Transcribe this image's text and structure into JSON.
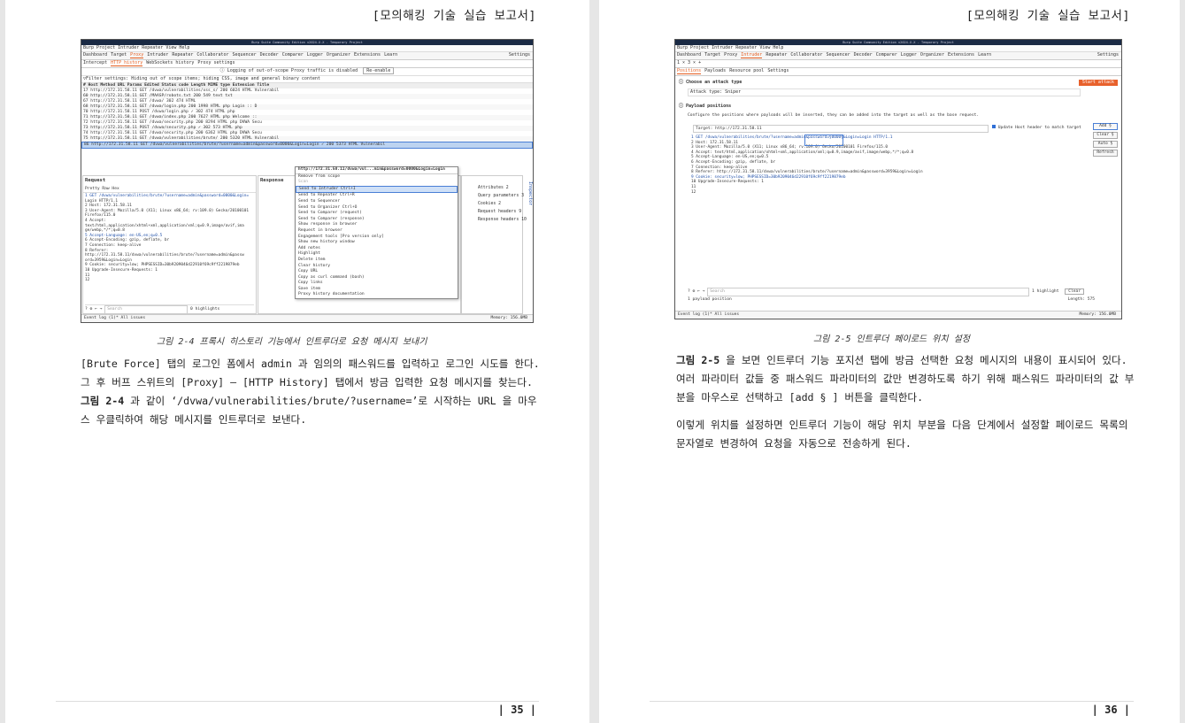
{
  "pages": [
    {
      "header": "[모의해킹 기술 실습 보고서]",
      "caption": "그림 2-4 프록시 히스토리 기능에서 인트루더로 요청 메시지 보내기",
      "paragraphs": [
        {
          "before": "[Brute Force] 탭의 로그인 폼에서 admin 과 임의의 패스워드를 입력하고 로그인 시도를 한다. 그 후 버프 스위트의 [Proxy] – [HTTP History] 탭에서 방금 입력한 요청 메시지를 찾는다. ",
          "bold": "그림 2-4",
          "after": " 과 같이 ‘/dvwa/vulnerabilities/brute/?username=’로 시작하는 URL 을 마우스 우클릭하여 해당 메시지를 인트루더로 보낸다."
        }
      ],
      "page_number": "| 35 |",
      "screenshot": {
        "window_title": "Burp Suite Community Edition v2024.X.X - Temporary Project",
        "menu": "Burp  Project  Intruder  Repeater  View  Help",
        "tabs": [
          "Dashboard",
          "Target",
          "Proxy",
          "Intruder",
          "Repeater",
          "Collaborator",
          "Sequencer",
          "Decoder",
          "Comparer",
          "Logger",
          "Organizer",
          "Extensions",
          "Learn"
        ],
        "settings_label": "Settings",
        "subtabs": [
          "Intercept",
          "HTTP history",
          "WebSockets history",
          "Proxy settings"
        ],
        "notice": "Logging of out-of-scope Proxy traffic is disabled",
        "notice_button": "Re-enable",
        "filter": "Filter settings: Hiding out of scope items; hiding CSS, image and general binary content",
        "columns": "#    Host                 Method   URL                                         Params  Edited  Status code  Length  MIME type  Extension  Title",
        "rows": [
          "17   http://172.31.58.11   GET      /dvwa/vulnerabilities/xss_s/                                      200          6024    HTML                  Vulnerabil",
          "60   http://172.31.58.11   GET      /MAASP/robots.txt                                                 200          549     text       txt",
          "67   http://172.31.58.11   GET      /dvwa/                                                            302          474     HTML",
          "68   http://172.31.58.11   GET      /dvwa/login.php                                                   200          1998    HTML       php        Login :: D",
          "70   http://172.31.58.11   POST     /dvwa/login.php                                ✓                  302          474     HTML       php",
          "71   http://172.31.58.11   GET      /dvwa/index.php                                                   200          7627    HTML       php        Welcome ::",
          "72   http://172.31.58.11   GET      /dvwa/security.php                                                200          8294    HTML       php        DVWA Secu",
          "73   http://172.31.58.11   POST     /dvwa/security.php                             ✓                  302          573     HTML       php",
          "74   http://172.31.58.11   GET      /dvwa/security.php                                                200          6362    HTML       php        DVWA Secu",
          "75   http://172.31.58.11   GET      /dvwa/vulnerabilities/brute/                                      200          5320    HTML                  Vulnerabil",
          "86   http://172.31.58.11   GET      /dvwa/vulnerabilities/brute/?username=admin&password=0000&Login=Login   ✓   200   5373   HTML          Vulnerabil"
        ],
        "request_title": "Request",
        "request_tabs": "Pretty   Raw   Hex",
        "request_lines": [
          "1  GET /dvwa/vulnerabilities/brute/?username=admin&password=0000&Login=",
          "   Login HTTP/1.1",
          "2  Host: 172.31.58.11",
          "3  User-Agent: Mozilla/5.0 (X11; Linux x86_64; rv:109.0) Gecko/20100101",
          "   Firefox/115.0",
          "4  Accept:",
          "   text/html,application/xhtml+xml,application/xml;q=0.9,image/avif,ima",
          "   ge/webp,*/*;q=0.8",
          "5  Accept-Language: en-US,en;q=0.5",
          "6  Accept-Encoding: gzip, deflate, br",
          "7  Connection: keep-alive",
          "8  Referer:",
          "   http://172.31.58.11/dvwa/vulnerabilities/brute/?username=admin&passw",
          "   ord=3959&Login=Login",
          "9  Cookie: security=low; PHPSESSID=30b9209046d22910f69c9ff2219879eb",
          "10 Upgrade-Insecure-Requests: 1",
          "11",
          "12"
        ],
        "response_title": "Response",
        "search_placeholder": "Search",
        "highlights_label": "0 highlights",
        "context_menu": [
          "http://172.31.58.11/dvwa/vul...min&password=0000&Login=Login",
          "Remove from scope",
          "Scan",
          "Send to Intruder          Ctrl+I",
          "Send to Repeater          Ctrl+R",
          "Send to Sequencer",
          "Send to Organizer         Ctrl+O",
          "Send to Comparer (request)",
          "Send to Comparer (response)",
          "Show response in browser",
          "Request in browser",
          "Engagement tools [Pro version only]",
          "Show new history window",
          "Add notes",
          "Highlight",
          "Delete item",
          "Clear history",
          "Copy URL",
          "Copy as curl command (bash)",
          "Copy links",
          "Save item",
          "Proxy history documentation"
        ],
        "inspector_items": [
          "Attributes   2",
          "Query parameters   3",
          "Cookies   2",
          "Request headers   9",
          "Response headers   10"
        ],
        "inspector_label": "Inspector",
        "status_left": "Event log (1)*   All issues",
        "status_right": "Memory: 156.0MB"
      }
    },
    {
      "header": "[모의해킹 기술 실습 보고서]",
      "caption": "그림 2-5 인트루더 페이로드 위치 설정",
      "paragraphs": [
        {
          "before": "",
          "bold": "그림 2-5",
          "after": " 을 보면 인트루더 기능 포지션 탭에 방금 선택한 요청 메시지의 내용이 표시되어 있다. 여러 파라미터 값들 중 패스워드 파라미터의 값만 변경하도록 하기 위해 패스워드 파라미터의 값 부분을 마우스로 선택하고 [add § ] 버튼을 클릭한다."
        },
        {
          "before": "이렇게 위치를 설정하면 인트루더 기능이 해당 위치 부분을 다음 단계에서 설정할 페이로드 목록의 문자열로 변경하여 요청을 자동으로 전송하게 된다.",
          "bold": "",
          "after": ""
        }
      ],
      "page_number": "| 36 |",
      "screenshot": {
        "window_title": "Burp Suite Community Edition v2024.X.X - Temporary Project",
        "menu": "Burp  Project  Intruder  Repeater  View  Help",
        "tabs": [
          "Dashboard",
          "Target",
          "Proxy",
          "Intruder",
          "Repeater",
          "Collaborator",
          "Sequencer",
          "Decoder",
          "Comparer",
          "Logger",
          "Organizer",
          "Extensions",
          "Learn"
        ],
        "settings_label": "Settings",
        "attack_tabs": "1 ×   3 ×   +",
        "subtabs": [
          "Positions",
          "Payloads",
          "Resource pool",
          "Settings"
        ],
        "choose_attack": "Choose an attack type",
        "start_attack": "Start attack",
        "attack_type": "Attack type:  Sniper",
        "payload_positions": "Payload positions",
        "payload_desc": "Configure the positions where payloads will be inserted, they can be added into the target as well as the base request.",
        "target": "Target:  http://172.31.58.11",
        "update_host": "Update Host header to match target",
        "buttons": [
          "Add §",
          "Clear §",
          "Auto §",
          "Refresh"
        ],
        "request_lines": [
          "1  GET /dvwa/vulnerabilities/brute/?username=admin&password=§0000§&Login=Login HTTP/1.1",
          "2  Host: 172.31.58.11",
          "3  User-Agent: Mozilla/5.0 (X11; Linux x86_64; rv:109.0) Gecko/20100101 Firefox/115.0",
          "4  Accept: text/html,application/xhtml+xml,application/xml;q=0.9,image/avif,image/webp,*/*;q=0.8",
          "5  Accept-Language: en-US,en;q=0.5",
          "6  Accept-Encoding: gzip, deflate, br",
          "7  Connection: keep-alive",
          "8  Referer: http://172.31.58.11/dvwa/vulnerabilities/brute/?username=admin&password=3959&Login=Login",
          "9  Cookie: security=low; PHPSESSID=30b9209046d22910f69c9ff2219879eb",
          "10 Upgrade-Insecure-Requests: 1",
          "11",
          "12"
        ],
        "search_placeholder": "Search",
        "highlight_label": "1 highlight",
        "clear_label": "Clear",
        "payload_position_count": "1 payload position",
        "length_label": "Length: 575",
        "status_left": "Event log (1)*   All issues",
        "status_right": "Memory: 156.0MB"
      }
    }
  ],
  "colors": {
    "accent_orange": "#e8612c",
    "selection_blue": "#bcd3f0",
    "title_bar": "#1a2a44"
  }
}
